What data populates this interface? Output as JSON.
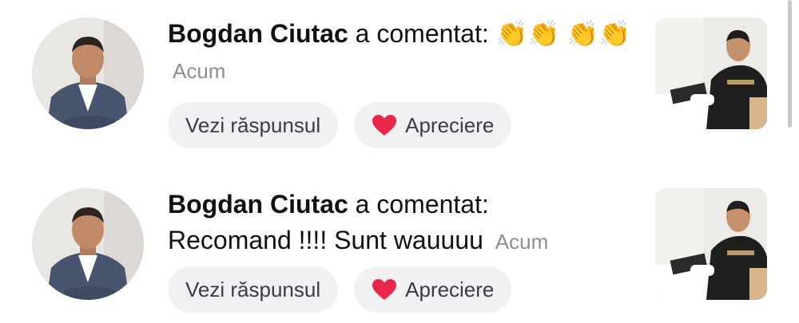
{
  "notifications": [
    {
      "user": "Bogdan Ciutac",
      "action": "a comentat:",
      "comment": "👏👏 👏👏",
      "time": "Acum",
      "reply_label": "Vezi răspunsul",
      "like_label": "Apreciere"
    },
    {
      "user": "Bogdan Ciutac",
      "action": "a comentat:",
      "comment": "Recomand !!!! Sunt wauuuu",
      "time": "Acum",
      "reply_label": "Vezi răspunsul",
      "like_label": "Apreciere"
    }
  ],
  "colors": {
    "heart": "#e8274b",
    "pill_bg": "#f1f1f3",
    "time_text": "#8e8e93"
  },
  "icons": {
    "like": "heart-icon",
    "avatar": "user-avatar",
    "thumbnail": "video-thumbnail"
  }
}
